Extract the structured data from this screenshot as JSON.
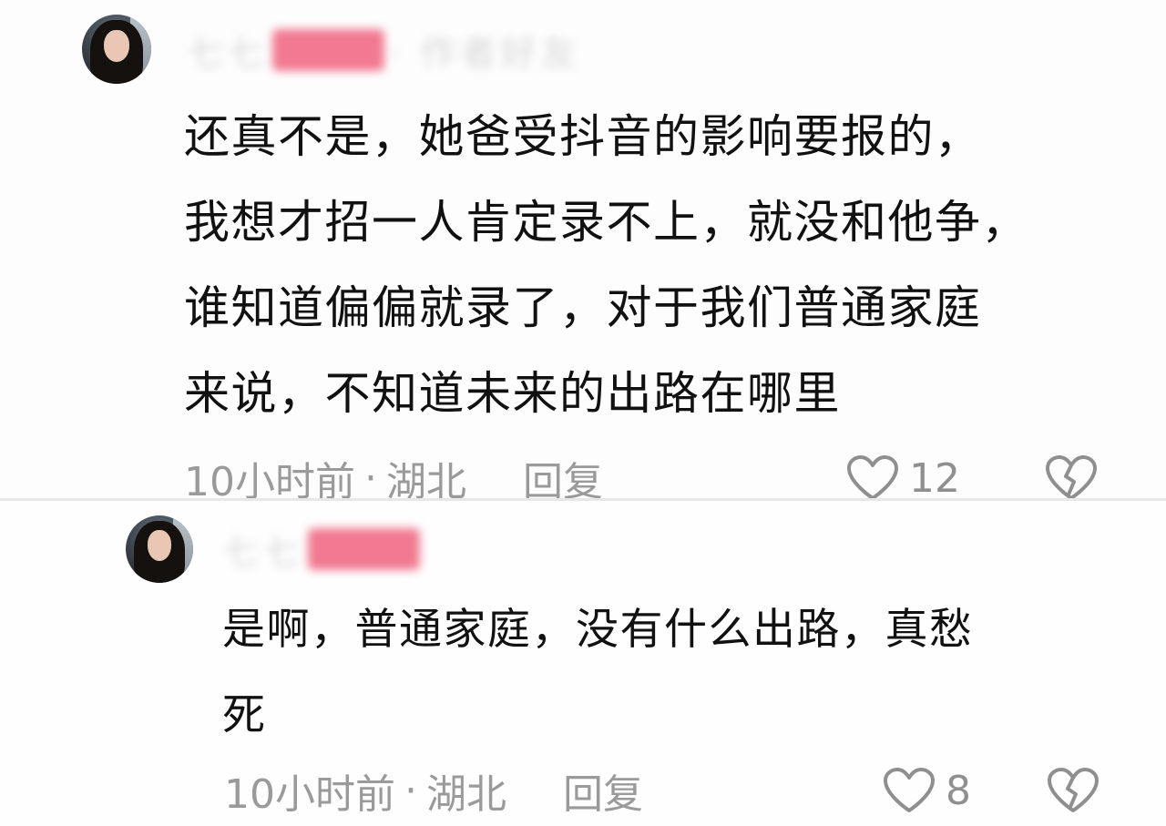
{
  "comments": [
    {
      "username": {
        "pre": "七七",
        "mask": "xxxx",
        "post": "· 作者好友"
      },
      "text": "还真不是，她爸受抖音的影响要报的，\n我想才招一人肯定录不上，就没和他争，\n谁知道偏偏就录了，对于我们普通家庭\n来说，不知道未来的出路在哪里",
      "time": "10小时前",
      "location": "湖北",
      "reply_label": "回复",
      "likes": "12",
      "like_icon": "heart-outline-icon",
      "dislike_icon": "broken-heart-icon"
    },
    {
      "username": {
        "pre": "七七",
        "mask": "xxxx",
        "post": ""
      },
      "text": "是啊，普通家庭，没有什么出路，真愁\n死",
      "time": "10小时前",
      "location": "湖北",
      "reply_label": "回复",
      "likes": "8",
      "like_icon": "heart-outline-icon",
      "dislike_icon": "broken-heart-icon"
    }
  ],
  "meta_separator": "·",
  "colors": {
    "mask": "#f06b86",
    "meta": "#9a9a9a",
    "text": "#111111"
  }
}
